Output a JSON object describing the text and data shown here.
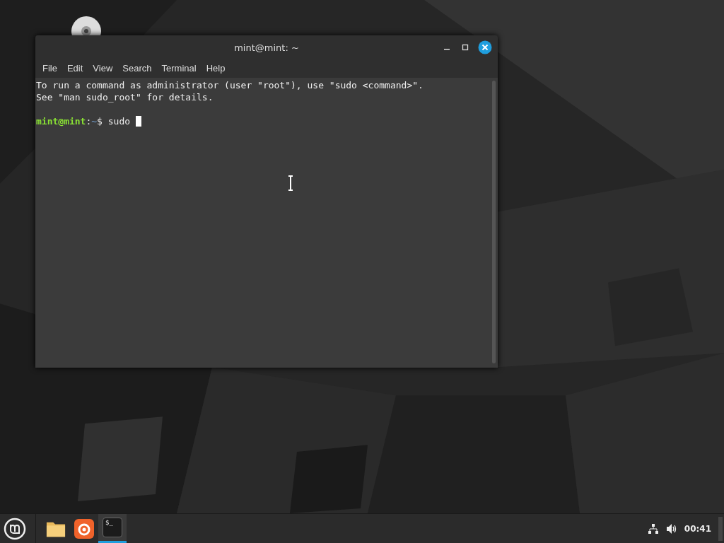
{
  "window": {
    "title": "mint@mint: ~"
  },
  "menu": [
    "File",
    "Edit",
    "View",
    "Search",
    "Terminal",
    "Help"
  ],
  "terminal": {
    "lines": [
      "To run a command as administrator (user \"root\"), use \"sudo <command>\".",
      "See \"man sudo_root\" for details."
    ],
    "prompt": {
      "user_host": "mint@mint",
      "separator": ":",
      "path": "~",
      "symbol": "$",
      "input": "sudo "
    },
    "cursor": true
  },
  "taskbar": {
    "apps": [
      {
        "kind": "files",
        "selected": false
      },
      {
        "kind": "software",
        "selected": false
      },
      {
        "kind": "terminal",
        "label": "$_",
        "selected": true
      }
    ],
    "clock": "00:41"
  }
}
